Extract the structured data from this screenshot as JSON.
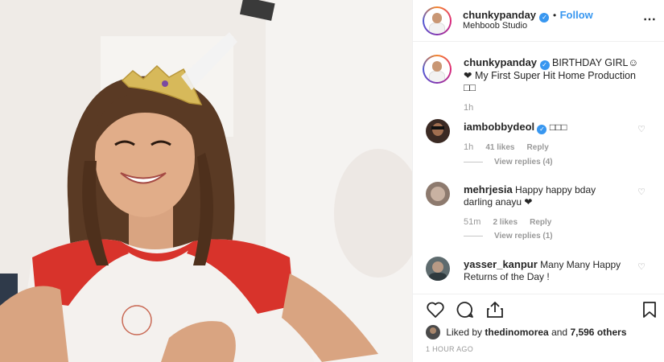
{
  "post": {
    "username": "chunkypanday",
    "follow_label": "Follow",
    "location": "Mehboob Studio",
    "more_icon": "more-options-icon"
  },
  "caption": {
    "username": "chunkypanday",
    "text": "BIRTHDAY GIRL☺ ❤ My First Super Hit Home Production □□",
    "time": "1h"
  },
  "comments": [
    {
      "username": "iambobbydeol",
      "verified": true,
      "text": "□□□",
      "time": "1h",
      "likes": "41 likes",
      "reply": "Reply",
      "view_replies": "View replies (4)"
    },
    {
      "username": "mehrjesia",
      "verified": false,
      "text": "Happy happy bday darling anayu ❤",
      "time": "51m",
      "likes": "2 likes",
      "reply": "Reply",
      "view_replies": "View replies (1)"
    },
    {
      "username": "yasser_kanpur",
      "verified": false,
      "text": "Many Many Happy Returns of the Day !"
    }
  ],
  "likes_line": {
    "prefix": "Liked by",
    "user": "thedinomorea",
    "mid": "and",
    "others": "7,596 others"
  },
  "timestamp": "1 HOUR AGO",
  "colors": {
    "link": "#3897f0",
    "text": "#262626",
    "muted": "#999999",
    "border": "#efefef"
  }
}
